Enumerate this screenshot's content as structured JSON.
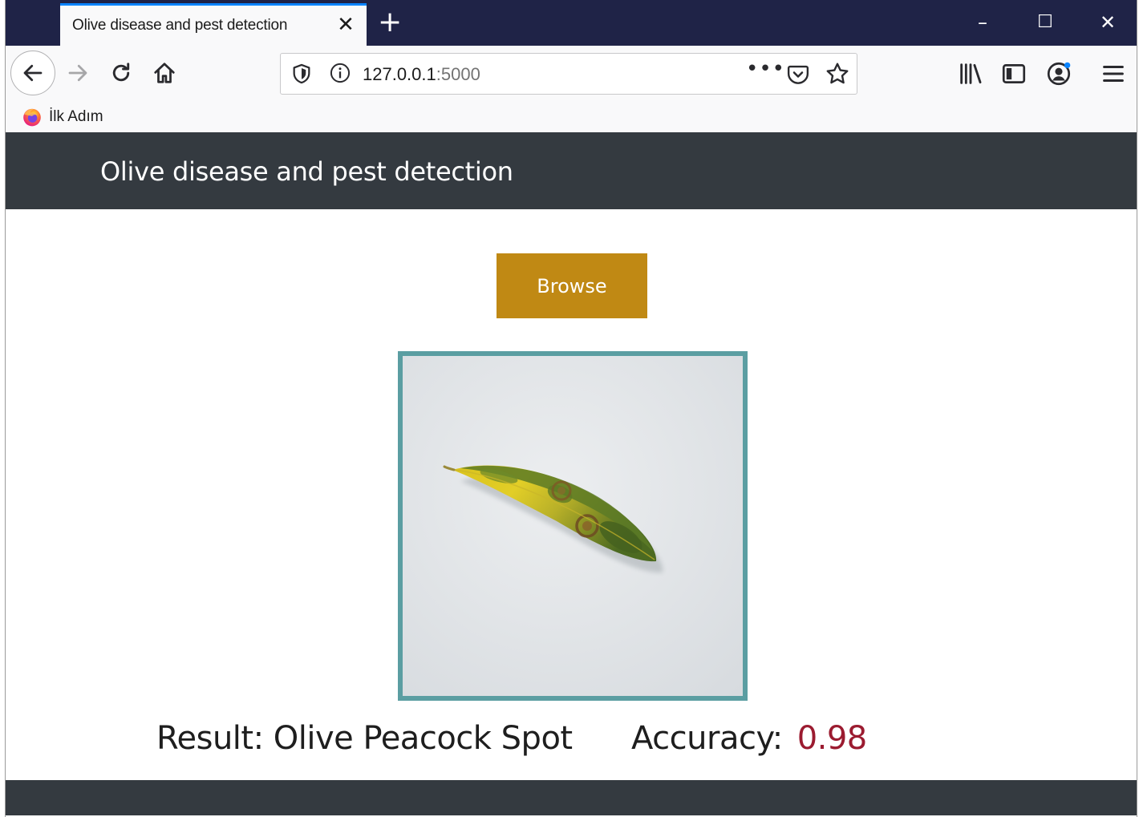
{
  "browser": {
    "tab_title": "Olive disease and pest detection",
    "tab_close": "✕",
    "new_tab": "+",
    "window_controls": {
      "minimize": "–",
      "maximize": "☐",
      "close": "✕"
    },
    "url_host": "127.0.0.1",
    "url_port": ":5000",
    "url_more": "•••",
    "bookmark_label": "İlk Adım",
    "icons": [
      "back-arrow-icon",
      "forward-arrow-icon",
      "reload-icon",
      "home-icon",
      "shield-icon",
      "info-icon",
      "pocket-icon",
      "star-icon",
      "library-icon",
      "sidebar-icon",
      "account-icon",
      "menu-icon",
      "firefox-icon"
    ]
  },
  "app": {
    "title": "Olive disease and pest detection",
    "browse_label": "Browse",
    "result_label": "Result:",
    "result_value": "Olive Peacock Spot",
    "accuracy_label": "Accuracy:",
    "accuracy_value": "0.98",
    "colors": {
      "header": "#343a40",
      "browse_button": "#c08914",
      "image_border": "#5b9ea2",
      "accuracy_value": "#9b1b30"
    }
  }
}
